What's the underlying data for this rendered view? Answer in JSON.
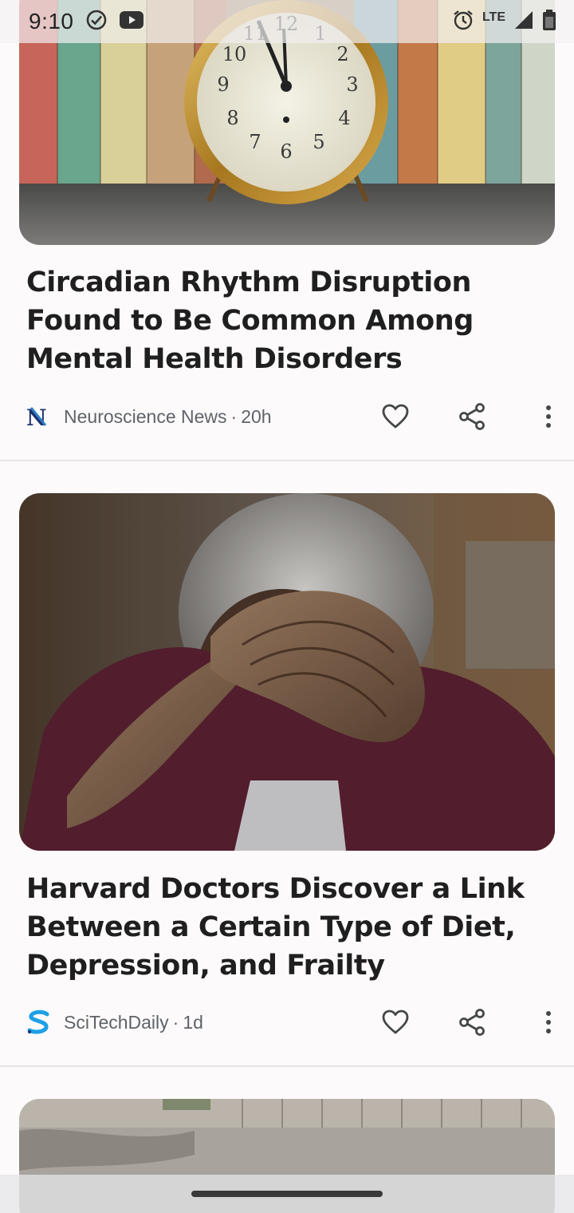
{
  "status_bar": {
    "time": "9:10",
    "network": "LTE",
    "icons": [
      "check-circle-icon",
      "youtube-icon",
      "alarm-icon",
      "signal-icon",
      "battery-icon"
    ]
  },
  "articles": [
    {
      "image": "alarm-clock-photo",
      "title": "Circadian Rhythm Disruption Found to Be Common Among Mental Health Disorders",
      "source": "Neuroscience News",
      "age": "20h",
      "source_logo": "neuroscience-news-logo"
    },
    {
      "image": "elderly-man-photo",
      "title": "Harvard Doctors Discover a Link Between a Certain Type of Diet, Depression, and Frailty",
      "source": "SciTechDaily",
      "age": "1d",
      "source_logo": "scitechdaily-logo"
    },
    {
      "image": "street-photo"
    }
  ],
  "clock_numbers": [
    "12",
    "1",
    "2",
    "3",
    "4",
    "5",
    "6",
    "7",
    "8",
    "9",
    "10",
    "11"
  ],
  "colors": {
    "background": "#fcfafb",
    "title_text": "#1f1f1f",
    "meta_text": "#5f6368",
    "icon": "#444746"
  }
}
